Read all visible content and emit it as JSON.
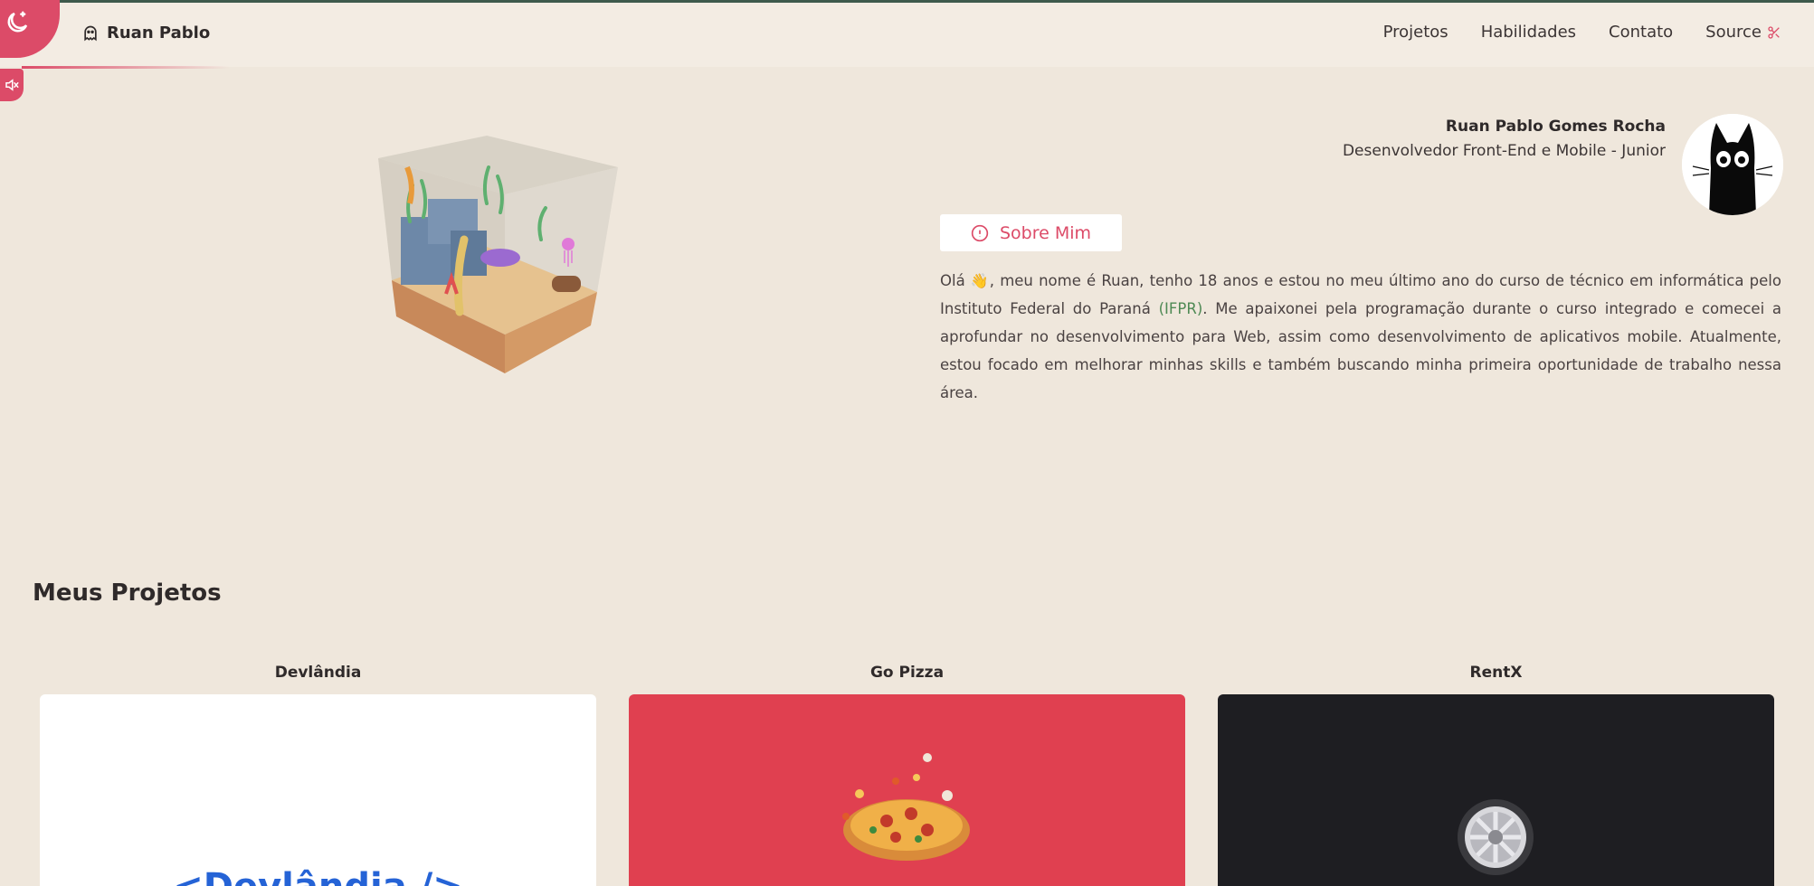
{
  "header": {
    "brand": "Ruan Pablo",
    "nav": [
      {
        "label": "Projetos"
      },
      {
        "label": "Habilidades"
      },
      {
        "label": "Contato"
      },
      {
        "label": "Source"
      }
    ]
  },
  "profile": {
    "name": "Ruan Pablo Gomes Rocha",
    "role": "Desenvolvedor Front-End e Mobile - Junior"
  },
  "about": {
    "button_label": "Sobre Mim",
    "bio_before": "Olá ",
    "bio_emoji": "👋",
    "bio_part1": ", meu nome é Ruan, tenho 18 anos e estou no meu último ano do curso de técnico em informática pelo Instituto Federal do Paraná ",
    "bio_highlight": "(IFPR)",
    "bio_part2": ". Me apaixonei pela programação durante o curso integrado e comecei a aprofundar no desenvolvimento para Web, assim como desenvolvimento de aplicativos mobile. Atualmente, estou focado em melhorar minhas skills e também buscando minha primeira oportunidade de trabalho nessa área."
  },
  "projects": {
    "title": "Meus Projetos",
    "items": [
      {
        "name": "Devlândia",
        "logo_text": "<Devlândia />"
      },
      {
        "name": "Go Pizza"
      },
      {
        "name": "RentX"
      }
    ]
  },
  "colors": {
    "accent": "#dc4b68",
    "background": "#efe7dc",
    "header": "#f3ece3",
    "highlight": "#4f8a55"
  },
  "icons": [
    "moon-stars-icon",
    "mute-icon",
    "ghost-icon",
    "scissors-icon",
    "info-icon"
  ]
}
